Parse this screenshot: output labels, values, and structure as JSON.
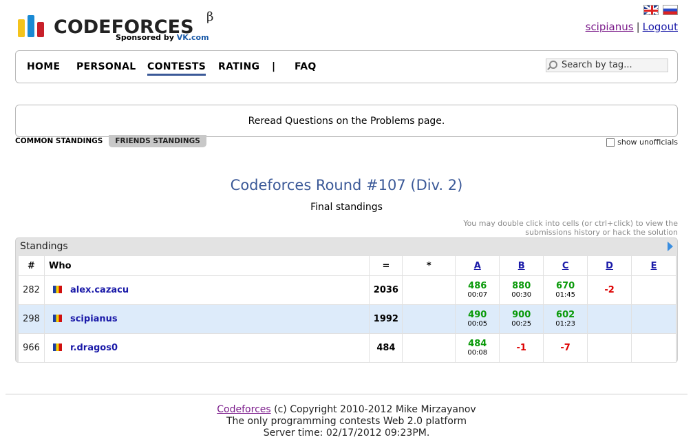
{
  "header": {
    "logo_text": "CODEFORCES",
    "logo_beta": "β",
    "sponsored_prefix": "Sponsored by",
    "sponsored_brand": "VK.com",
    "user": "scipianus",
    "separator": "|",
    "logout": "Logout",
    "flags": [
      "uk-flag",
      "russia-flag"
    ]
  },
  "menu": {
    "items": [
      "HOME",
      "PERSONAL",
      "CONTESTS",
      "RATING",
      "|",
      "FAQ"
    ],
    "active": "CONTESTS",
    "search_placeholder": "Search by tag..."
  },
  "announcement": "Reread Questions on the Problems page.",
  "tabs": {
    "common": "COMMON STANDINGS",
    "friends": "FRIENDS STANDINGS",
    "selected": "FRIENDS STANDINGS",
    "show_unofficial": "show unofficials"
  },
  "contest": {
    "title": "Codeforces Round #107 (Div. 2)",
    "subtitle": "Final standings",
    "hint_line1": "You may double click into cells (or ctrl+click) to view the",
    "hint_line2": "submissions history or hack the solution"
  },
  "standings": {
    "header": "Standings",
    "columns": [
      "#",
      "Who",
      "=",
      "*",
      "A",
      "B",
      "C",
      "D",
      "E"
    ],
    "rows": [
      {
        "rank": "282",
        "handle": "alex.cazacu",
        "points": "2036",
        "penalty": "",
        "A": {
          "score": "486",
          "time": "00:07"
        },
        "B": {
          "score": "880",
          "time": "00:30"
        },
        "C": {
          "score": "670",
          "time": "01:45"
        },
        "D": {
          "rej": "-2"
        },
        "E": {}
      },
      {
        "rank": "298",
        "handle": "scipianus",
        "points": "1992",
        "penalty": "",
        "A": {
          "score": "490",
          "time": "00:05"
        },
        "B": {
          "score": "900",
          "time": "00:25"
        },
        "C": {
          "score": "602",
          "time": "01:23"
        },
        "D": {},
        "E": {}
      },
      {
        "rank": "966",
        "handle": "r.dragos0",
        "points": "484",
        "penalty": "",
        "A": {
          "score": "484",
          "time": "00:08"
        },
        "B": {
          "rej": "-1"
        },
        "C": {
          "rej": "-7"
        },
        "D": {},
        "E": {}
      }
    ]
  },
  "footer": {
    "link": "Codeforces",
    "copyright": "(c) Copyright 2010-2012 Mike Mirzayanov",
    "line2": "The only programming contests Web 2.0 platform",
    "line3": "Server time: 02/17/2012 09:23PM."
  }
}
